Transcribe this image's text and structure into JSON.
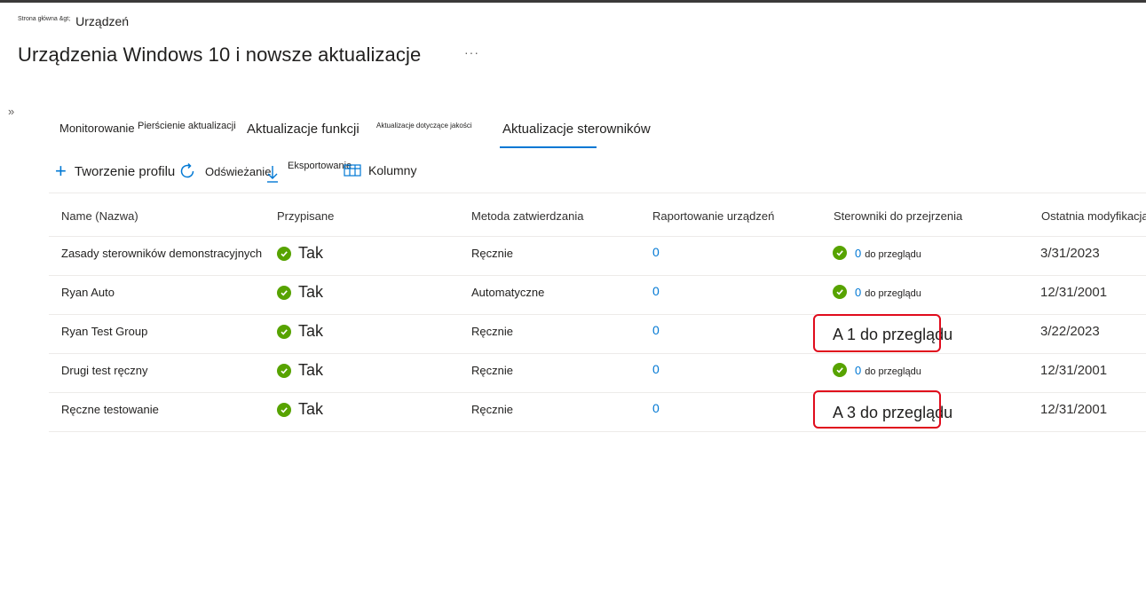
{
  "breadcrumb": {
    "home": "Strona główna &gt;",
    "current": "Urządzeń"
  },
  "page": {
    "title": "Urządzenia Windows 10 i nowsze aktualizacje",
    "more_label": "···",
    "expand_label": "»"
  },
  "tabs": [
    {
      "label": "Monitorowanie"
    },
    {
      "label": "Pierścienie aktualizacji"
    },
    {
      "label": "Aktualizacje funkcji"
    },
    {
      "label": "Aktualizacje dotyczące jakości"
    },
    {
      "label": "Aktualizacje sterowników",
      "active": true
    }
  ],
  "toolbar": {
    "create_label": "Tworzenie profilu",
    "refresh_label": "Odświeżanie",
    "export_label": "Eksportowanie",
    "columns_label": "Kolumny"
  },
  "table": {
    "headers": [
      "Name (Nazwa)",
      "Przypisane",
      "Metoda zatwierdzania",
      "Raportowanie urządzeń",
      "Sterowniki do przejrzenia",
      "Ostatnia modyfikacja"
    ],
    "rows": [
      {
        "name": "Zasady sterowników demonstracyjnych",
        "assigned": "Tak",
        "method": "Ręcznie",
        "reporting": "0",
        "drivers_count": "0",
        "drivers_text": "do przeglądu",
        "modified": "3/31/2023"
      },
      {
        "name": "Ryan Auto",
        "assigned": "Tak",
        "method": "Automatyczne",
        "reporting": "0",
        "drivers_count": "0",
        "drivers_text": "do przeglądu",
        "modified": "12/31/2001"
      },
      {
        "name": "Ryan Test Group",
        "assigned": "Tak",
        "method": "Ręcznie",
        "reporting": "0",
        "drivers_alert": "A 1 do przeglądu",
        "modified": "3/22/2023"
      },
      {
        "name": "Drugi test ręczny",
        "assigned": "Tak",
        "method": "Ręcznie",
        "reporting": "0",
        "drivers_count": "0",
        "drivers_text": "do przeglądu",
        "modified": "12/31/2001"
      },
      {
        "name": "Ręczne testowanie",
        "assigned": "Tak",
        "method": "Ręcznie",
        "reporting": "0",
        "drivers_alert": "A 3 do przeglądu",
        "modified": "12/31/2001"
      }
    ]
  },
  "colors": {
    "accent": "#0078d4",
    "success": "#57a300",
    "highlight": "#e00b1c"
  },
  "icons": [
    "chevron-double-right-icon",
    "plus-icon",
    "refresh-icon",
    "download-icon",
    "columns-icon",
    "check-circle-icon"
  ]
}
